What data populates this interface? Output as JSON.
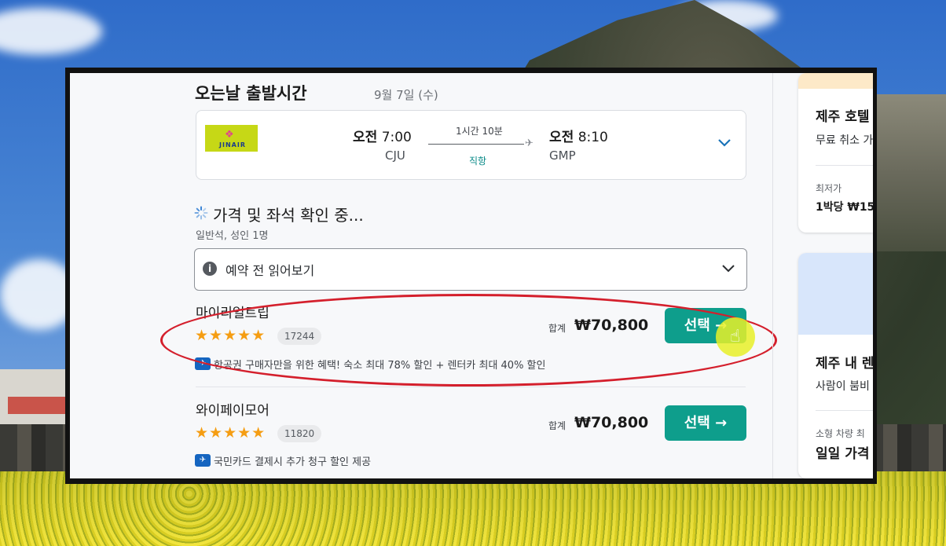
{
  "return_flight": {
    "section_title": "오는날 출발시간",
    "date": "9월 7일 (수)",
    "airline_logo_text": "JINAIR",
    "departure_time_prefix": "오전",
    "departure_time": "7:00",
    "departure_code": "CJU",
    "duration": "1시간 10분",
    "stop_type": "직항",
    "arrival_time_prefix": "오전",
    "arrival_time": "8:10",
    "arrival_code": "GMP"
  },
  "status": {
    "checking_text": "가격 및 좌석 확인 중...",
    "cabin_pax": "일반석, 성인 1명"
  },
  "notice": {
    "label": "예약 전 읽어보기"
  },
  "agencies": [
    {
      "name": "마이리얼트립",
      "rating_stars": 5,
      "review_count": "17244",
      "promo": "항공권 구매자만을 위한 혜택! 숙소 최대 78% 할인 + 렌터카 최대 40% 할인",
      "total_label": "합계",
      "price": "₩70,800",
      "select_label": "선택"
    },
    {
      "name": "와이페이모어",
      "rating_stars": 5,
      "review_count": "11820",
      "promo": "국민카드 결제시 추가 청구 할인 제공",
      "total_label": "합계",
      "price": "₩70,800",
      "select_label": "선택"
    }
  ],
  "sidebar": {
    "hotel_card": {
      "title": "제주 호텔",
      "subtitle": "무료 취소 가",
      "lowest_label": "최저가",
      "per_night": "1박당 ₩15"
    },
    "car_card": {
      "title": "제주 내 렌",
      "subtitle": "사람이 붐비",
      "small_car_label": "소형 차량 최",
      "daily_price": "일일 가격"
    }
  },
  "colors": {
    "accent_teal": "#0e9e8c",
    "star_orange": "#f59d12",
    "highlight_red": "#d41f2c",
    "promo_blue": "#1565c0"
  }
}
